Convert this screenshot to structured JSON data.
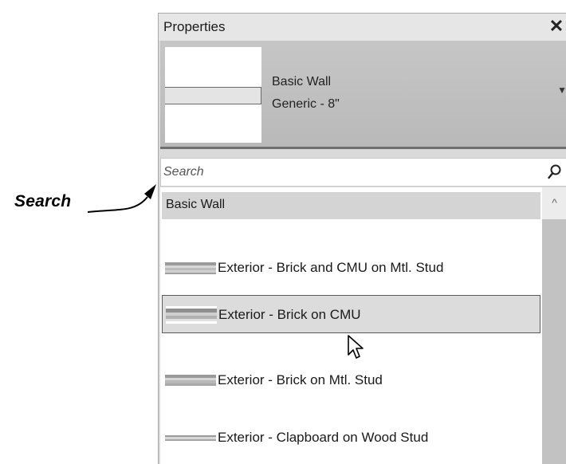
{
  "callout": {
    "label": "Search"
  },
  "panel": {
    "title": "Properties",
    "close_symbol": "✕"
  },
  "type_selector": {
    "family": "Basic Wall",
    "type": "Generic - 8\"",
    "dropdown_symbol": "▼"
  },
  "search": {
    "placeholder": "Search",
    "value": "",
    "icon": "search-icon"
  },
  "list": {
    "group": "Basic Wall",
    "items": [
      {
        "label": "Exterior - Brick and CMU on Mtl. Stud",
        "selected": false
      },
      {
        "label": "Exterior - Brick on CMU",
        "selected": true
      },
      {
        "label": "Exterior - Brick on Mtl. Stud",
        "selected": false
      },
      {
        "label": "Exterior - Clapboard on Wood Stud",
        "selected": false
      }
    ],
    "scroll_up_symbol": "^"
  },
  "colors": {
    "panel_bg": "#d9d9d9",
    "title_bar": "#e6e6e6",
    "type_selector": "#c0c0c0",
    "selection_border": "#5a5a5a",
    "group_header": "#d4d4d4",
    "scroll_thumb": "#c2c2c2"
  }
}
